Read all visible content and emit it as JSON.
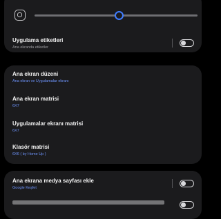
{
  "top": {
    "icon": "app-grid-icon",
    "slider_value": 0.52,
    "labels_title": "Uygulama etiketleri",
    "labels_sub": "Ana ekranda etiketler",
    "labels_toggle_on": false
  },
  "layout_settings": {
    "items": [
      {
        "title": "Ana ekran düzeni",
        "sub": "Ana ekran ve Uygulamalar ekranı"
      },
      {
        "title": "Ana ekran matrisi",
        "sub": "6X7"
      },
      {
        "title": "Uygulamalar ekranı matrisi",
        "sub": "6X7"
      },
      {
        "title": "Klasör matrisi",
        "sub": "6X6 ( by Home Up )"
      }
    ]
  },
  "bottom": {
    "media_title": "Ana ekrana medya sayfası ekle",
    "media_sub": "Google Keşfet",
    "media_toggle_on": false
  },
  "colors": {
    "accent": "#3e7cff",
    "background": "#000000",
    "card": "#1b1b1d"
  }
}
